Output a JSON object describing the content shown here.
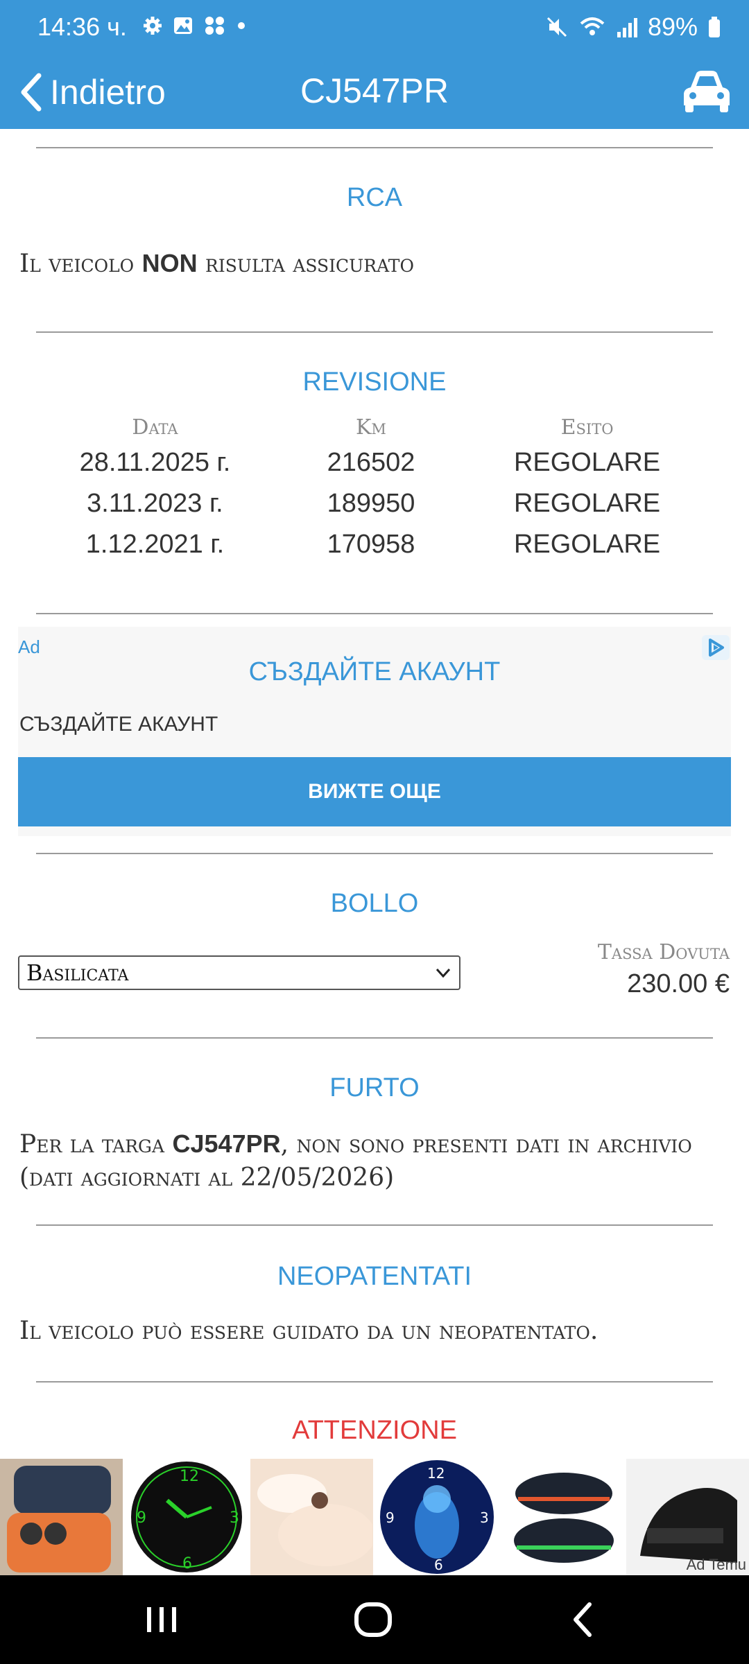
{
  "status_bar": {
    "time": "14:36 ч.",
    "battery": "89%",
    "icons": [
      "settings-icon",
      "gallery-icon",
      "apps-icon",
      "dot-icon",
      "mute-icon",
      "wifi-icon",
      "signal-icon",
      "battery-icon"
    ]
  },
  "app_bar": {
    "back_label": "Indietro",
    "title": "CJ547PR",
    "right_icon": "car-icon"
  },
  "rca": {
    "title": "RCA",
    "text_before": "Il veicolo ",
    "text_bold": "NON",
    "text_after": " risulta assicurato"
  },
  "revisione": {
    "title": "REVISIONE",
    "headers": [
      "Data",
      "Km",
      "Esito"
    ],
    "rows": [
      [
        "28.11.2025 г.",
        "216502",
        "REGOLARE"
      ],
      [
        "3.11.2023 г.",
        "189950",
        "REGOLARE"
      ],
      [
        "1.12.2021 г.",
        "170958",
        "REGOLARE"
      ]
    ]
  },
  "ad": {
    "label": "Ad",
    "title": "СЪЗДАЙТЕ АКАУНТ",
    "subtitle": "СЪЗДАЙТЕ АКАУНТ",
    "cta": "ВИЖТЕ ОЩЕ"
  },
  "bollo": {
    "title": "BOLLO",
    "region_selected": "Basilicata",
    "tax_label": "Tassa Dovuta",
    "tax_value": "230.00 €"
  },
  "furto": {
    "title": "FURTO",
    "text_before": "Per la targa ",
    "plate": "CJ547PR",
    "text_after": ", non sono presenti dati in archivio (dati aggiornati al 22/05/2026)"
  },
  "neopatentati": {
    "title": "NEOPATENTATI",
    "text": "Il veicolo può essere guidato da un neopatentato."
  },
  "attenzione": {
    "title": "ATTENZIONE"
  },
  "bottom_ad": {
    "label": "Ad  Temu",
    "items": [
      "phone-case-image",
      "glow-clock-image",
      "bedding-image",
      "cat-clock-image",
      "slippers-image",
      "sandal-image"
    ]
  },
  "colors": {
    "primary": "#3a97d8",
    "warning": "#e23b3b"
  }
}
